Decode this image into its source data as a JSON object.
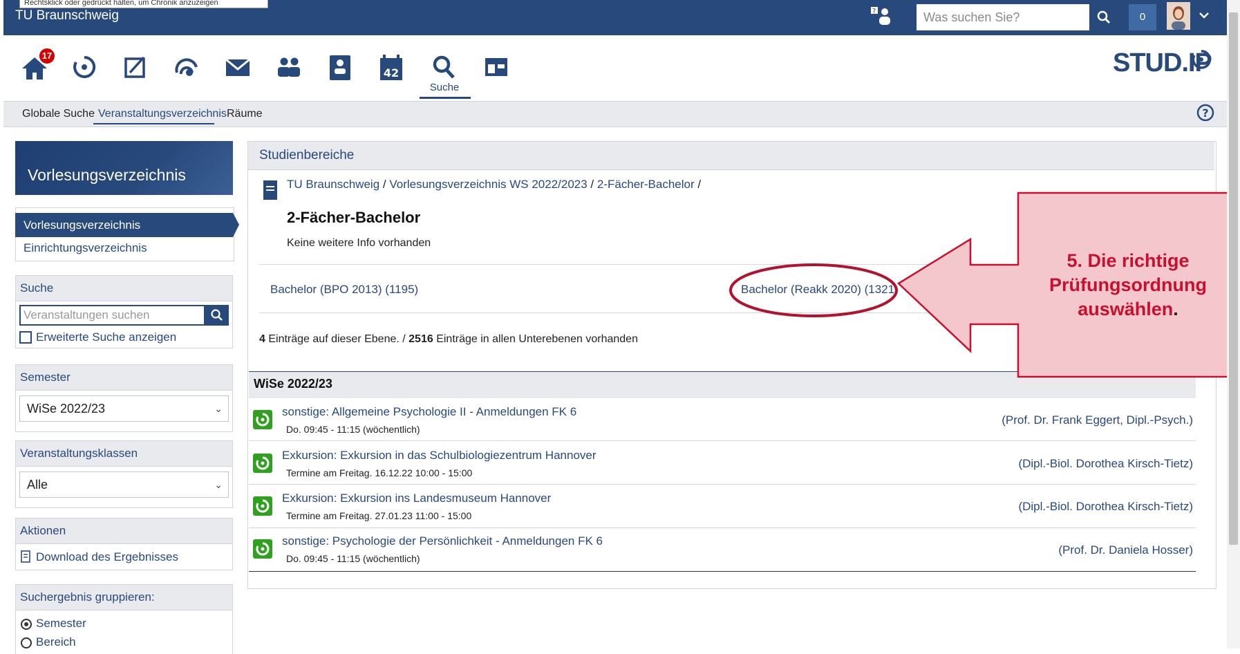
{
  "top": {
    "tooltip_fragment": "Rechtsklick oder gedrückt halten, um Chronik anzuzeigen",
    "brand": "TU Braunschweig",
    "search_placeholder": "Was suchen Sie?",
    "notification_count": "0"
  },
  "nav": {
    "home_badge": "17",
    "active_label": "Suche",
    "calendar_number": "42",
    "logo_text": "STUD.IP",
    "icons": [
      "home-icon",
      "my-courses-icon",
      "workspace-icon",
      "community-icon",
      "messages-icon",
      "contacts-icon",
      "profile-icon",
      "calendar-icon",
      "search-icon",
      "tools-icon"
    ]
  },
  "subnav": {
    "tabs": [
      "Globale Suche",
      "Veranstaltungsverzeichnis",
      "Räume"
    ],
    "active_tab": "Veranstaltungsverzeichnis"
  },
  "sidebar": {
    "header": "Vorlesungsverzeichnis",
    "nav_items": [
      "Vorlesungsverzeichnis",
      "Einrichtungsverzeichnis"
    ],
    "search": {
      "title": "Suche",
      "placeholder": "Veranstaltungen suchen",
      "advanced_label": "Erweiterte Suche anzeigen"
    },
    "semester": {
      "title": "Semester",
      "selected": "WiSe 2022/23"
    },
    "classes": {
      "title": "Veranstaltungsklassen",
      "selected": "Alle"
    },
    "actions": {
      "title": "Aktionen",
      "download_label": "Download des Ergebnisses"
    },
    "group": {
      "title": "Suchergebnis gruppieren:",
      "options": [
        "Semester",
        "Bereich"
      ],
      "selected": "Semester"
    }
  },
  "main": {
    "header": "Studienbereiche",
    "breadcrumb": [
      "TU Braunschweig",
      "Vorlesungsverzeichnis WS 2022/2023",
      "2-Fächer-Bachelor"
    ],
    "level_title": "2-Fächer-Bachelor",
    "level_info": "Keine weitere Info vorhanden",
    "subareas": [
      "Bachelor (BPO 2013) (1195)",
      "Bachelor (Reakk 2020) (1321)"
    ],
    "counts": {
      "level_count": "4",
      "level_text": " Einträge auf dieser Ebene.",
      "separator": " / ",
      "all_count": "2516",
      "all_text": " Einträge in allen Unterebenen vorhanden"
    },
    "semester_group": "WiSe 2022/23",
    "courses": [
      {
        "title": "sonstige: Allgemeine Psychologie II - Anmeldungen FK 6",
        "time": "Do. 09:45 - 11:15 (wöchentlich)",
        "lecturers": "(Prof. Dr. Frank Eggert, Dipl.-Psych.)"
      },
      {
        "title": "Exkursion: Exkursion in das Schulbiologiezentrum Hannover",
        "time": "Termine am Freitag. 16.12.22 10:00 - 15:00",
        "lecturers": "(Dipl.-Biol. Dorothea Kirsch-Tietz)"
      },
      {
        "title": "Exkursion: Exkursion ins Landesmuseum Hannover",
        "time": "Termine am Freitag. 27.01.23 11:00 - 15:00",
        "lecturers": "(Dipl.-Biol. Dorothea Kirsch-Tietz)"
      },
      {
        "title": "sonstige: Psychologie der Persönlichkeit - Anmeldungen FK 6",
        "time": "Do. 09:45 - 11:15 (wöchentlich)",
        "lecturers": "(Prof. Dr. Daniela Hosser)"
      }
    ]
  },
  "annotation": {
    "lines": [
      "5. Die richtige",
      "Prüfungsordnung",
      "auswählen"
    ],
    "trailing": ".",
    "fill": "#f4c7cd",
    "stroke": "#c8102e"
  },
  "colors": {
    "primary": "#28497c",
    "panel": "#e8eaee",
    "accent_green": "#2fa01f",
    "badge_red": "#d60000"
  }
}
